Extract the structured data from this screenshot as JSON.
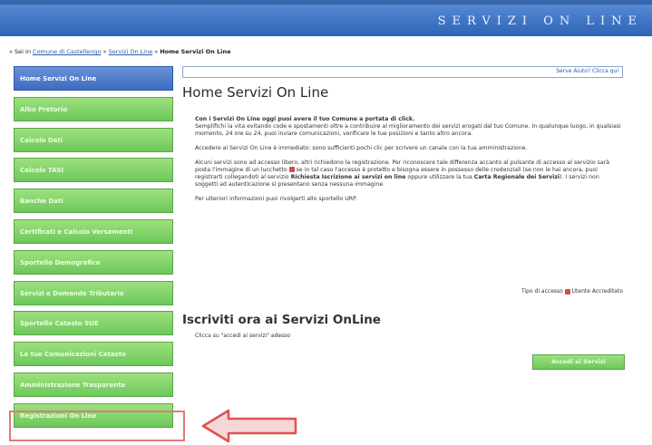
{
  "header": {
    "brand": "SERVIZI ON LINE"
  },
  "breadcrumb": {
    "prefix": "» Sei in",
    "links": [
      "Comune di Castellengo",
      "Servizi On Line"
    ],
    "current": "Home Servizi On Line"
  },
  "sidebar": {
    "items": [
      {
        "label": "Home Servizi On Line"
      },
      {
        "label": "Albo Pretorio"
      },
      {
        "label": "Calcolo Dati"
      },
      {
        "label": "Calcolo TASI"
      },
      {
        "label": "Banche Dati"
      },
      {
        "label": "Certificati e Calcolo Versamenti"
      },
      {
        "label": "Sportello Demografico"
      },
      {
        "label": "Servizi e Domande Tributarie"
      },
      {
        "label": "Sportello Catasto SUE"
      },
      {
        "label": "Le tue Comunicazioni Catasto"
      },
      {
        "label": "Amministrazione Trasparente"
      },
      {
        "label": "Registrazioni On Line"
      }
    ]
  },
  "help_link": "Serve Aiuto? Clicca qui",
  "main": {
    "title": "Home Servizi On Line",
    "lead": "Con i Servizi On Line oggi puoi avere il tuo Comune a portata di click.",
    "p1": "Semplifichi la vita evitando code e spostamenti oltre a contribuire al miglioramento dei servizi erogati dal tuo Comune. In qualunque luogo, in qualsiasi momento, 24 ore su 24, puoi inviare comunicazioni, verificare le tue posizioni e tanto altro ancora.",
    "p2": "Accedere ai Servizi On Line è immediato: sono sufficienti pochi clic per scrivere un canale con la tua amministrazione.",
    "p3a": "Alcuni servizi sono ad accesso libero, altri richiedono la registrazione. Per riconoscere tale differenza accanto al pulsante di accesso al servizio sarà posta l'immagine di un lucchetto",
    "p3b": "se in tal caso l'accesso è protetto e bisogna essere in possesso delle credenziali (se non le hai ancora, puoi registrarti collegandoti al servizio",
    "p3_bold1": "Richiesta Iscrizione ai servizi on line",
    "p3c": "oppure utilizzare la tua",
    "p3_bold2": "Carta Regionale dei Servizi",
    "p3d": "). I servizi non soggetti ad autenticazione si presentano senza nessuna immagine.",
    "p4": "Per ulteriori informazioni puoi rivolgerti allo sportello URP.",
    "legend_left": "Tipo di accesso",
    "legend_right": "Utente Accreditato",
    "h2": "Iscriviti ora ai Servizi OnLine",
    "sub": "Clicca su \"accedi ai servizi\" adesso",
    "cta": "Accedi ai Servizi"
  },
  "colors": {
    "header_blue": "#2f63b6",
    "sidebar_green": "#6cc85a",
    "active_blue": "#3c6cc0",
    "highlight_red": "#e07a7a",
    "arrow_red": "#e05050"
  }
}
